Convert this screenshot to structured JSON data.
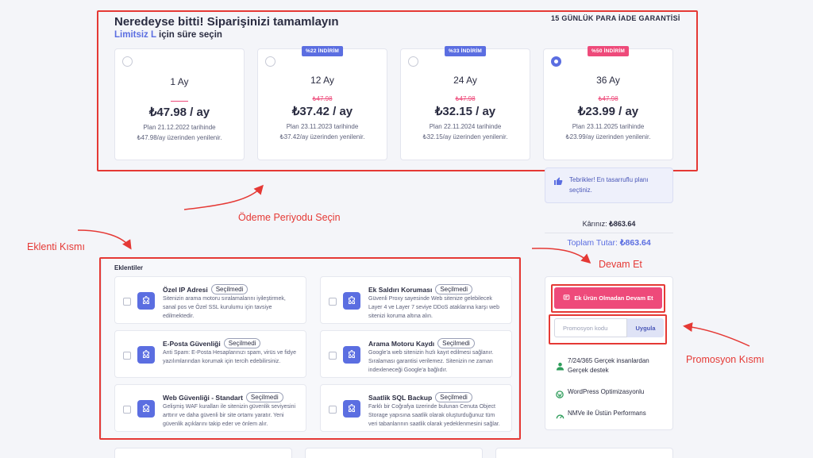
{
  "header": {
    "title": "Neredeyse bitti! Siparişinizi tamamlayın",
    "plan_name": "Limitsiz L",
    "subtitle_rest": " için süre seçin",
    "guarantee": "15 GÜNLÜK PARA İADE GARANTİSİ"
  },
  "plans": [
    {
      "name": "1 Ay",
      "badge": "",
      "old_price": "",
      "price": "₺47.98 / ay",
      "renew_line1": "Plan 21.12.2022 tarihinde",
      "renew_line2": "₺47.98/ay üzerinden yenilenir.",
      "selected": false
    },
    {
      "name": "12 Ay",
      "badge": "%22 İNDİRİM",
      "old_price": "₺47.98",
      "price": "₺37.42 / ay",
      "renew_line1": "Plan 23.11.2023 tarihinde",
      "renew_line2": "₺37.42/ay üzerinden yenilenir.",
      "selected": false
    },
    {
      "name": "24 Ay",
      "badge": "%33 İNDİRİM",
      "old_price": "₺47.98",
      "price": "₺32.15 / ay",
      "renew_line1": "Plan 22.11.2024 tarihinde",
      "renew_line2": "₺32.15/ay üzerinden yenilenir.",
      "selected": false
    },
    {
      "name": "36 Ay",
      "badge": "%50 İNDİRİM",
      "old_price": "₺47.98",
      "price": "₺23.99 / ay",
      "renew_line1": "Plan 23.11.2025 tarihinde",
      "renew_line2": "₺23.99/ay üzerinden yenilenir.",
      "selected": true
    }
  ],
  "notice": {
    "line1": "Tebrikler! En tasarruflu planı",
    "line2": "seçtiniz."
  },
  "summary": {
    "savings_label": "Kârınız:",
    "savings_value": "₺863.64",
    "total_label": "Toplam Tutar:",
    "total_value": "₺863.64"
  },
  "annotations": {
    "payment_period": "Ödeme Periyodu Seçin",
    "extensions": "Eklenti Kısmı",
    "continue": "Devam Et",
    "promo": "Promosyon Kısmı"
  },
  "extensions": {
    "title": "Eklentiler",
    "selected_label": "Seçilmedi",
    "items": [
      {
        "name": "Özel IP Adresi",
        "desc": "Sitenizin arama motoru sıralamalarını iyileştirmek, sanal pos ve Özel SSL kurulumu için tavsiye edilmektedir."
      },
      {
        "name": "Ek Saldırı Koruması",
        "desc": "Güvenli Proxy sayesinde Web sitenize gelebilecek Layer 4 ve Layer 7 seviye DDoS ataklarına karşı web sitenizi koruma altına alın."
      },
      {
        "name": "E-Posta Güvenliği",
        "desc": "Anti Spam: E-Posta Hesaplarınızı spam, virüs ve fidye yazılımlarından korumak için tercih edebilirsiniz."
      },
      {
        "name": "Arama Motoru Kaydı",
        "desc": "Google'a web sitenizin hızlı kayıt edilmesi sağlanır. Sıralaması garantisi verilemez. Sitenizin ne zaman indexleneceği Google'a bağlıdır."
      },
      {
        "name": "Web Güvenliği - Standart",
        "desc": "Gelişmiş WAF kuralları ile sitenizin güvenlik seviyesini arttırır ve daha güvenli bir site ortamı yaratır. Yeni güvenlik açıklarını takip eder ve önlem alır."
      },
      {
        "name": "Saatlik SQL Backup",
        "desc": "Farklı bir Coğrafya üzerinde bulunan Cenuta Object Storage yapısına saatlik olarak oluşturduğunuz tüm veri tabanlarının saatlik olarak yedeklenmesini sağlar."
      }
    ]
  },
  "actions": {
    "continue_button": "Ek Ürün Olmadan Devam Et",
    "promo_placeholder": "Promosyon kodu",
    "promo_apply": "Uygula"
  },
  "features": [
    {
      "line1": "7/24/365 Gerçek insanlardan",
      "line2": "Gerçek destek",
      "icon": "support-person-icon"
    },
    {
      "line1": "WordPress Optimizasyonlu",
      "line2": "",
      "icon": "wordpress-icon"
    },
    {
      "line1": "NMVe ile Üstün Performans",
      "line2": "",
      "icon": "speedometer-icon"
    }
  ],
  "colors": {
    "accent": "#5b6ee1",
    "pink": "#ee4a7a",
    "annotation_red": "#e53935"
  }
}
